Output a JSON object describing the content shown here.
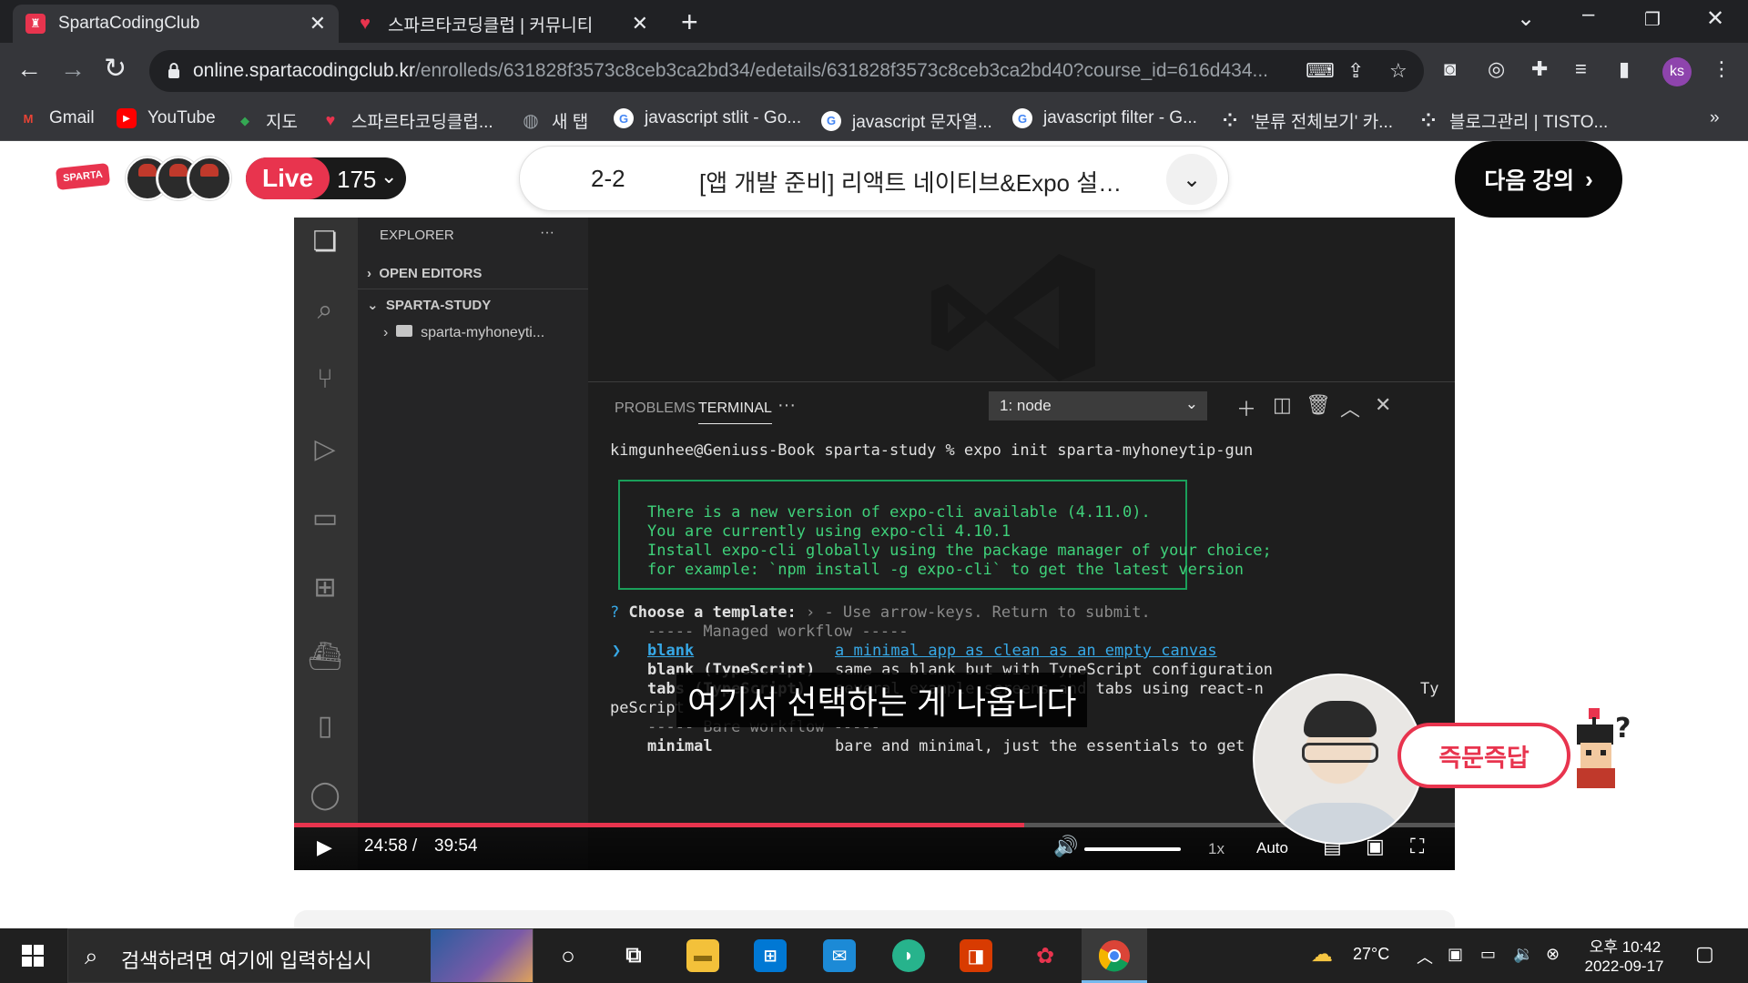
{
  "browser": {
    "tabs": [
      {
        "title": "SpartaCodingClub",
        "active": true,
        "favicon_color": "#e8344e"
      },
      {
        "title": "스파르타코딩클럽 | 커뮤니티",
        "active": false,
        "favicon_color": "#e8344e"
      }
    ],
    "new_tab_label": "+",
    "url_host": "online.spartacodingclub.kr",
    "url_path": "/enrolleds/631828f3573c8ceb3ca2bd34/edetails/631828f3573c8ceb3ca2bd40?course_id=616d434...",
    "profile_initials": "ks",
    "bookmarks": [
      {
        "label": "Gmail",
        "icon": "gmail-icon",
        "color": "#ea4335",
        "glyph": "M"
      },
      {
        "label": "YouTube",
        "icon": "youtube-icon",
        "color": "#ff0000",
        "glyph": "▶"
      },
      {
        "label": "지도",
        "icon": "maps-icon",
        "color": "#34a853",
        "glyph": "◆"
      },
      {
        "label": "스파르타코딩클럽...",
        "icon": "sparta-icon",
        "color": "#e8344e",
        "glyph": "♥"
      },
      {
        "label": "새 탭",
        "icon": "globe-icon",
        "color": "#9aa0a6",
        "glyph": "◍"
      },
      {
        "label": "javascript stlit - Go...",
        "icon": "google-icon",
        "color": "#ffffff",
        "glyph": "G"
      },
      {
        "label": "javascript 문자열...",
        "icon": "google-icon",
        "color": "#ffffff",
        "glyph": "G"
      },
      {
        "label": "javascript filter - G...",
        "icon": "google-icon",
        "color": "#ffffff",
        "glyph": "G"
      },
      {
        "label": "'분류 전체보기' 카...",
        "icon": "tistory-icon",
        "color": "#e8eaed",
        "glyph": "⁘"
      },
      {
        "label": "블로그관리 | TISTO...",
        "icon": "tistory-icon",
        "color": "#e8eaed",
        "glyph": "⁘"
      }
    ],
    "bookmarks_overflow": "»"
  },
  "page": {
    "logo_text": "SPARTA",
    "live_label": "Live",
    "live_count": "175",
    "lecture_number": "2-2",
    "lecture_title": "[앱 개발 준비] 리액트 네이티브&Expo 설…",
    "next_button_label": "다음 강의",
    "qa_label": "즉문즉답"
  },
  "vscode": {
    "explorer_title": "EXPLORER",
    "explorer_more": "···",
    "open_editors": "OPEN EDITORS",
    "workspace": "SPARTA-STUDY",
    "folder": "sparta-myhoneyti...",
    "panel_tabs": [
      "PROBLEMS",
      "TERMINAL"
    ],
    "panel_more": "···",
    "terminal_select": "1: node",
    "terminal": {
      "prompt": "kimgunhee@Geniuss-Book sparta-study % expo init sparta-myhoneytip-gun",
      "notice": [
        "There is a new version of expo-cli available (4.11.0).",
        "You are currently using expo-cli 4.10.1",
        "Install expo-cli globally using the package manager of your choice;",
        "for example: `npm install -g expo-cli` to get the latest version"
      ],
      "question_mark": "?",
      "question": "Choose a template:",
      "question_hint": "› - Use arrow-keys. Return to submit.",
      "managed_header": "----- Managed workflow -----",
      "pointer": "❯",
      "options": [
        {
          "name": "blank",
          "desc": "a minimal app as clean as an empty canvas"
        },
        {
          "name": "blank (TypeScript)",
          "desc": "same as blank but with TypeScript configuration"
        },
        {
          "name": "tabs (TypeScript)",
          "desc": "several example screens and tabs using react-n"
        }
      ],
      "wrap_tail": "Ty",
      "wrap_line": "peScript",
      "bare_header": "----- Bare workflow -----",
      "minimal": {
        "name": "minimal",
        "desc": "bare and minimal, just the essentials to get"
      }
    }
  },
  "video": {
    "subtitle": "여기서 선택하는 게 나옵니다",
    "current_time": "24:58 /",
    "duration": "39:54",
    "progress_fraction": 0.629,
    "buffer_fraction": 0.625,
    "speed": "1x",
    "quality": "Auto"
  },
  "taskbar": {
    "search_placeholder": "검색하려면 여기에 입력하십시",
    "weather_temp": "27°C",
    "time": "오후 10:42",
    "date": "2022-09-17"
  }
}
